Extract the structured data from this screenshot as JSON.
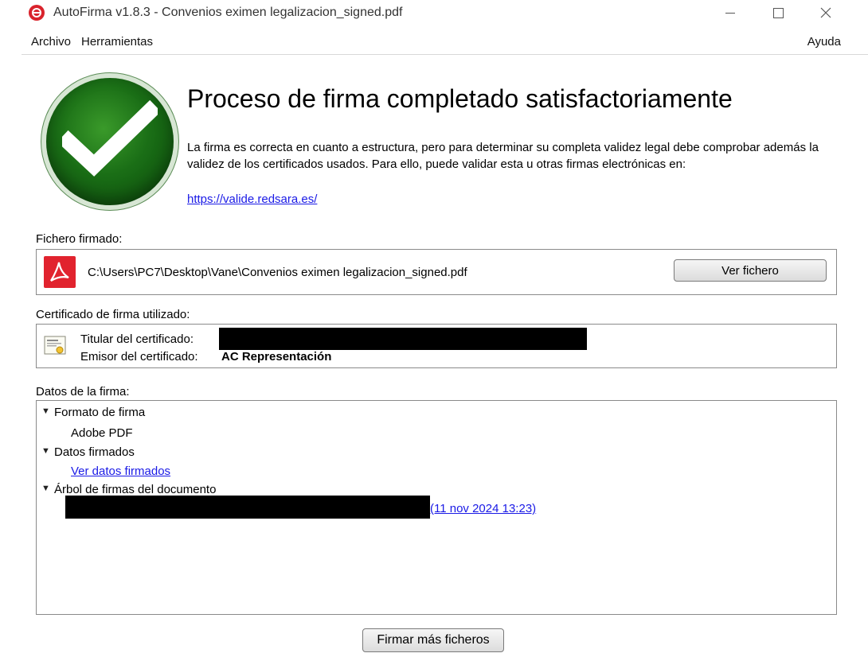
{
  "window": {
    "title": "AutoFirma v1.8.3 - Convenios eximen legalizacion_signed.pdf"
  },
  "menu": {
    "archivo": "Archivo",
    "herramientas": "Herramientas",
    "ayuda": "Ayuda"
  },
  "result": {
    "heading": "Proceso de firma completado satisfactoriamente",
    "description": "La firma es correcta en cuanto a estructura, pero para determinar su completa validez legal debe comprobar además la validez de los certificados usados. Para ello, puede validar esta u otras firmas electrónicas en:",
    "link": "https://valide.redsara.es/"
  },
  "signed_file": {
    "label": "Fichero firmado:",
    "path": "C:\\Users\\PC7\\Desktop\\Vane\\Convenios eximen legalizacion_signed.pdf",
    "button": "Ver fichero",
    "icon": "pdf-icon"
  },
  "certificate": {
    "label": "Certificado de firma utilizado:",
    "holder_label": "Titular del certificado:",
    "issuer_label": "Emisor del certificado:",
    "issuer_value": "AC Representación",
    "icon": "certificate-icon"
  },
  "signature_data": {
    "label": "Datos de la firma:",
    "format_label": "Formato de firma",
    "format_value": "Adobe PDF",
    "signed_data_label": "Datos firmados",
    "signed_data_link": "Ver datos firmados",
    "tree_label": "Árbol de firmas del documento",
    "tree_entry_date": "(11 nov 2024 13:23)"
  },
  "footer": {
    "sign_more_button": "Firmar más ficheros"
  },
  "colors": {
    "link": "#1a1ae6",
    "check_green": "#1a6e16",
    "pdf_red": "#e1232e"
  }
}
